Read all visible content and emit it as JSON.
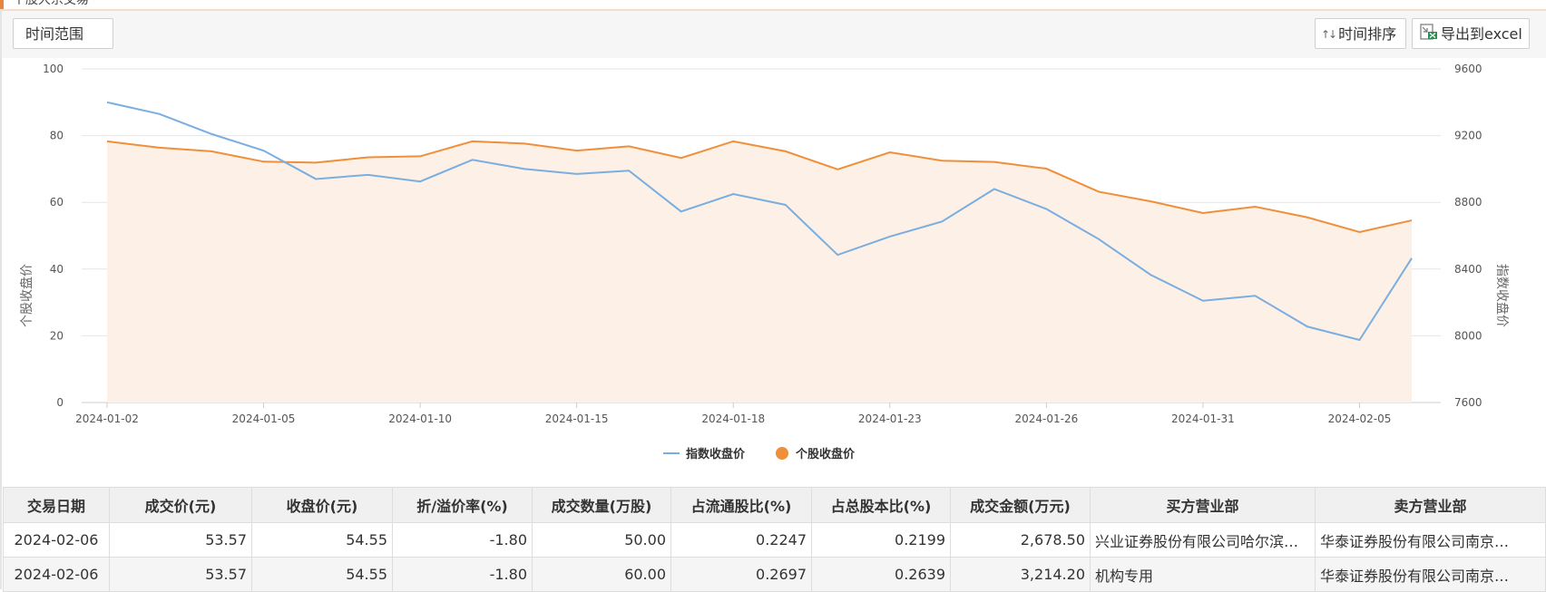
{
  "header": {
    "title": "个股大宗交易"
  },
  "toolbar": {
    "range_label": "时间范围",
    "sort_label": "时间排序",
    "export_label": "导出到excel"
  },
  "chart_data": {
    "type": "line",
    "ylabel": "个股收盘价",
    "y2label": "指数收盘价",
    "ylim": [
      0,
      100
    ],
    "y2lim": [
      7600,
      9600
    ],
    "yticks": [
      "100",
      "80",
      "60",
      "40",
      "20",
      "0"
    ],
    "y2ticks": [
      "9600",
      "9200",
      "8800",
      "8400",
      "8000",
      "7600"
    ],
    "xticks": [
      "2024-01-02",
      "2024-01-05",
      "2024-01-10",
      "2024-01-15",
      "2024-01-18",
      "2024-01-23",
      "2024-01-26",
      "2024-01-31",
      "2024-02-05"
    ],
    "legend_position": "bottom",
    "colors": {
      "index": "#7aaee0",
      "stock": "#ef8f3a",
      "area": "#fdf0e6"
    },
    "series": [
      {
        "name": "指数收盘价",
        "axis": "right",
        "values": [
          9400,
          9330,
          9210,
          9110,
          8940,
          8965,
          8925,
          9055,
          9000,
          8970,
          8990,
          8745,
          8850,
          8785,
          8485,
          8595,
          8685,
          8880,
          8760,
          8580,
          8365,
          8210,
          8240,
          8055,
          7975,
          8465
        ]
      },
      {
        "name": "个股收盘价",
        "axis": "left",
        "values": [
          78.3,
          76.4,
          75.3,
          72.2,
          71.9,
          73.5,
          73.8,
          78.3,
          77.6,
          75.5,
          76.8,
          73.3,
          78.3,
          75.3,
          69.9,
          75.0,
          72.5,
          72.1,
          70.1,
          63.2,
          60.3,
          56.8,
          58.7,
          55.5,
          51.1,
          54.6
        ]
      }
    ]
  },
  "table": {
    "columns": [
      "交易日期",
      "成交价(元)",
      "收盘价(元)",
      "折/溢价率(%)",
      "成交数量(万股)",
      "占流通股比(%)",
      "占总股本比(%)",
      "成交金额(万元)",
      "买方营业部",
      "卖方营业部"
    ],
    "rows": [
      [
        "2024-02-06",
        "53.57",
        "54.55",
        "-1.80",
        "50.00",
        "0.2247",
        "0.2199",
        "2,678.50",
        "兴业证券股份有限公司哈尔滨…",
        "华泰证券股份有限公司南京…"
      ],
      [
        "2024-02-06",
        "53.57",
        "54.55",
        "-1.80",
        "60.00",
        "0.2697",
        "0.2639",
        "3,214.20",
        "机构专用",
        "华泰证券股份有限公司南京…"
      ]
    ]
  }
}
